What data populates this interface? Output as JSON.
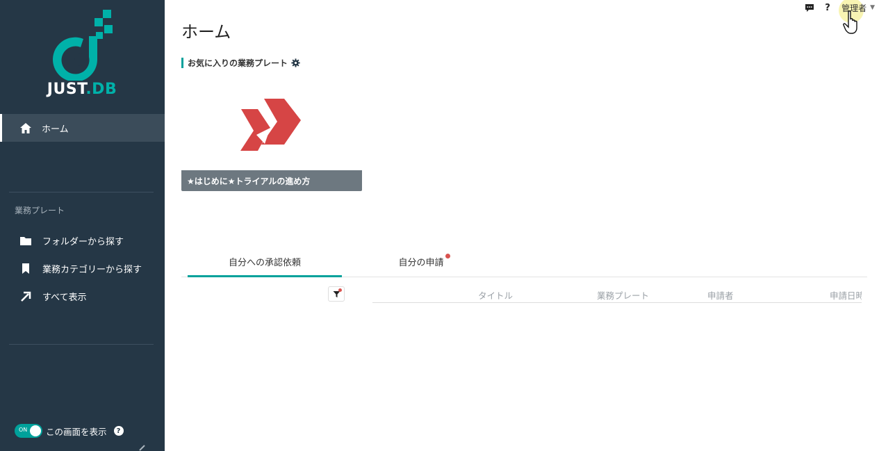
{
  "sidebar": {
    "logo_text_a": "JUST",
    "logo_text_b": ".DB",
    "home_label": "ホーム",
    "section_title": "業務プレート",
    "items": [
      {
        "label": "フォルダーから探す",
        "icon": "folder-icon"
      },
      {
        "label": "業務カテゴリーから探す",
        "icon": "bookmark-icon"
      },
      {
        "label": "すべて表示",
        "icon": "arrow-up-right-icon"
      }
    ],
    "toggle_state": "ON",
    "toggle_label": "この画面を表示",
    "help_glyph": "?"
  },
  "header": {
    "page_title": "ホーム",
    "help_glyph": "?",
    "user_name": "管理者",
    "user_caret": "▼"
  },
  "favorites": {
    "title": "お気に入りの業務プレート",
    "plate": {
      "caption": "★はじめに★トライアルの進め方"
    }
  },
  "tabs": [
    {
      "label": "自分への承認依頼",
      "active": true
    },
    {
      "label": "自分の申請",
      "active": false,
      "has_badge": true
    }
  ],
  "table": {
    "columns": [
      "タイトル",
      "業務プレート",
      "申請者",
      "申請日時"
    ]
  },
  "colors": {
    "sidebar_bg": "#253746",
    "accent": "#00a19b",
    "plate_icon": "#d64545",
    "badge": "#d9534f"
  }
}
